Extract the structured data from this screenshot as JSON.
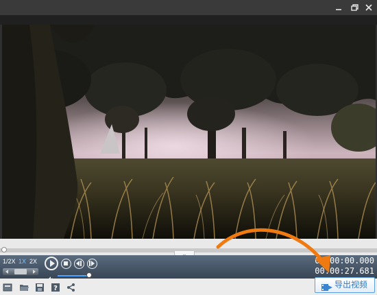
{
  "window": {
    "controls": [
      "minimize-icon",
      "restore-icon",
      "close-icon"
    ]
  },
  "player": {
    "speed": {
      "options": [
        "1/2X",
        "1X",
        "2X"
      ],
      "selected": "1X",
      "selected_color": "#7fc3ff"
    },
    "progress": 0.0,
    "volume": 0.95,
    "current_time": "00:00:00.000",
    "total_time": "00:00:27.681",
    "accent_color": "#4a90d9"
  },
  "toolbar": {
    "icons": [
      "new-project-icon",
      "open-folder-icon",
      "save-icon",
      "help-icon",
      "share-icon"
    ],
    "export_label": "导出视频"
  },
  "annotation": {
    "arrow_color": "#f07a12"
  }
}
